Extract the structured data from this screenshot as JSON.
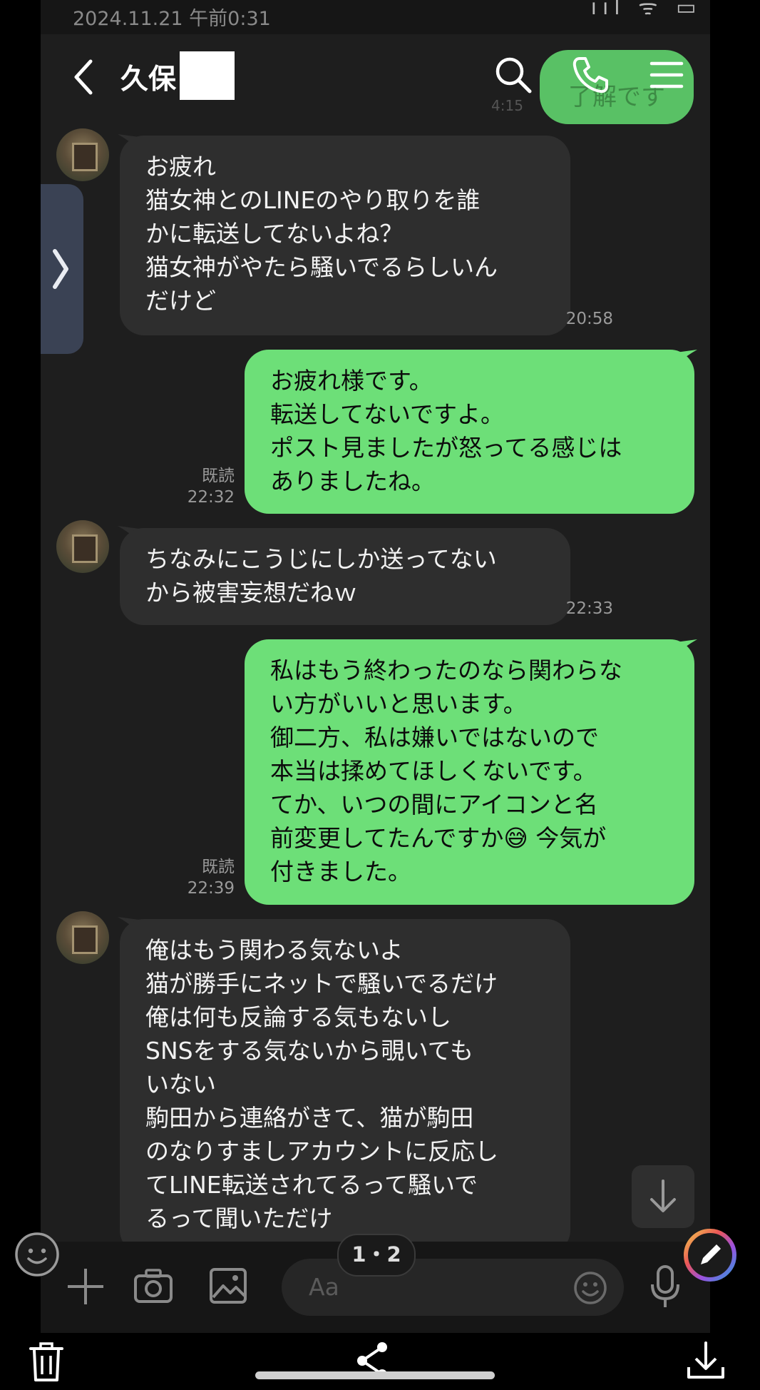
{
  "status": {
    "time": "2024.11.21 午前0:31",
    "icons": "ııl ᯤ ▭ ▮▮"
  },
  "header": {
    "title": "久保"
  },
  "ghost": {
    "text": "了解です",
    "time": "4:15"
  },
  "messages": [
    {
      "dir": "in",
      "text": "お疲れ\n猫女神とのLINEのやり取りを誰\nかに転送してないよね？\n猫女神がやたら騒いでるらしいん\nだけど",
      "time": "20:58"
    },
    {
      "dir": "out",
      "text": "お疲れ様です。\n転送してないですよ。\nポスト見ましたが怒ってる感じは\nありましたね。",
      "read": "既読",
      "time": "22:32"
    },
    {
      "dir": "in",
      "text": "ちなみにこうじにしか送ってない\nから被害妄想だねｗ",
      "time": "22:33"
    },
    {
      "dir": "out",
      "text": "私はもう終わったのなら関わらな\nい方がいいと思います。\n御二方、私は嫌いではないので\n本当は揉めてほしくないです。\nてか、いつの間にアイコンと名\n前変更してたんですか😅 今気が\n付きました。",
      "read": "既読",
      "time": "22:39"
    },
    {
      "dir": "in",
      "text": "俺はもう関わる気ないよ\n猫が勝手にネットで騒いでるだけ\n俺は何も反論する気もないし\nSNSをする気ないから覗いても\nいない\n駒田から連絡がきて、猫が駒田\nのなりすましアカウントに反応し\nてLINE転送されてるって騒いで\nるって聞いただけ",
      "time": ""
    }
  ],
  "page_indicator": "1・2",
  "input": {
    "placeholder": "Aa"
  }
}
